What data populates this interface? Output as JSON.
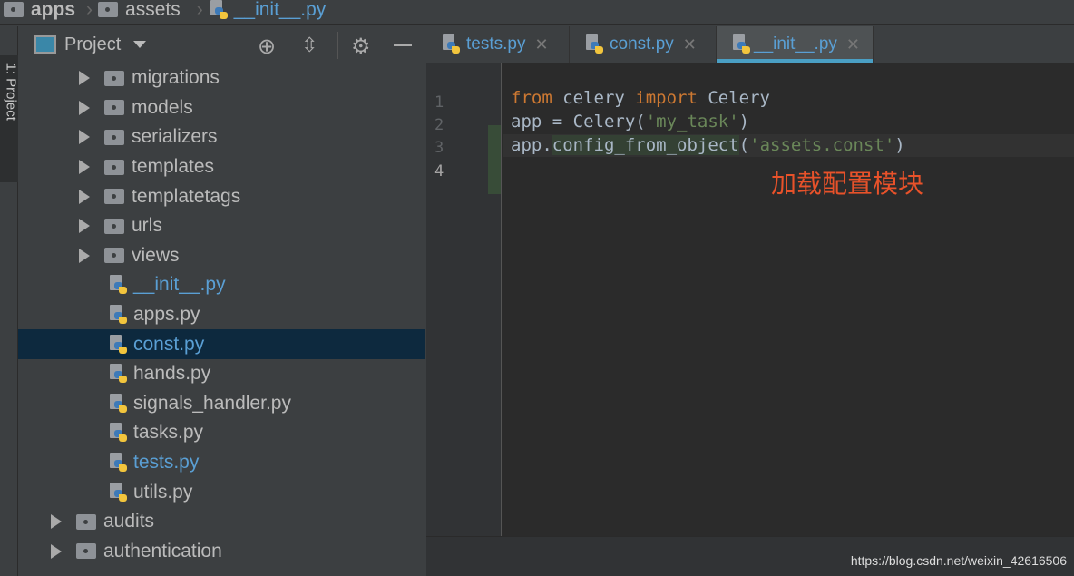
{
  "breadcrumb": [
    "apps",
    "assets",
    "__init__.py"
  ],
  "tool_strip": {
    "label": "1: Project"
  },
  "project_panel": {
    "title": "Project",
    "tree": [
      {
        "label": "migrations",
        "type": "folder",
        "level": 2
      },
      {
        "label": "models",
        "type": "folder",
        "level": 2
      },
      {
        "label": "serializers",
        "type": "folder",
        "level": 2
      },
      {
        "label": "templates",
        "type": "folder",
        "level": 2
      },
      {
        "label": "templatetags",
        "type": "folder",
        "level": 2
      },
      {
        "label": "urls",
        "type": "folder",
        "level": 2
      },
      {
        "label": "views",
        "type": "folder",
        "level": 2
      },
      {
        "label": "__init__.py",
        "type": "file",
        "level": 2,
        "modified": true
      },
      {
        "label": "apps.py",
        "type": "file",
        "level": 2
      },
      {
        "label": "const.py",
        "type": "file",
        "level": 2,
        "selected": true,
        "modified": true
      },
      {
        "label": "hands.py",
        "type": "file",
        "level": 2
      },
      {
        "label": "signals_handler.py",
        "type": "file",
        "level": 2
      },
      {
        "label": "tasks.py",
        "type": "file",
        "level": 2
      },
      {
        "label": "tests.py",
        "type": "file",
        "level": 2,
        "modified": true
      },
      {
        "label": "utils.py",
        "type": "file",
        "level": 2
      },
      {
        "label": "audits",
        "type": "folder",
        "level": 1
      },
      {
        "label": "authentication",
        "type": "folder",
        "level": 1
      }
    ]
  },
  "tabs": [
    {
      "label": "tests.py"
    },
    {
      "label": "const.py"
    },
    {
      "label": "__init__.py",
      "active": true
    }
  ],
  "editor": {
    "line_numbers": [
      "1",
      "2",
      "3",
      "4"
    ],
    "code": {
      "l2": [
        "from",
        " celery ",
        "import",
        " Celery"
      ],
      "l3": [
        "app = Celery(",
        "'my_task'",
        ")"
      ],
      "l4": [
        "app.",
        "config_from_object",
        "(",
        "'assets.const'",
        ")"
      ]
    },
    "annotation": "加载配置模块"
  },
  "watermark": "https://blog.csdn.net/weixin_42616506",
  "colors": {
    "accent": "#4a9fc4",
    "annotation": "#e8522a",
    "keyword": "#cc7832",
    "string": "#6a8759"
  }
}
